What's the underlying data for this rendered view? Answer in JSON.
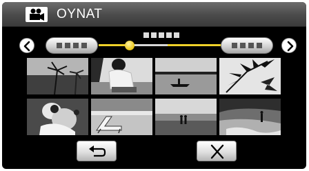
{
  "header": {
    "title": "OYNAT",
    "icon": "movie-camera-icon"
  },
  "navigation": {
    "prev_icon": "chevron-left-icon",
    "next_icon": "chevron-right-icon"
  },
  "thumbnails": [
    {
      "name": "palm-beach-thumbnail"
    },
    {
      "name": "seated-person-thumbnail"
    },
    {
      "name": "canoe-sunset-thumbnail"
    },
    {
      "name": "palm-leaves-thumbnail"
    },
    {
      "name": "couple-hug-thumbnail"
    },
    {
      "name": "beach-chair-thumbnail"
    },
    {
      "name": "silhouette-couple-thumbnail"
    },
    {
      "name": "shore-walk-thumbnail"
    }
  ],
  "buttons": {
    "back_icon": "return-arrow-icon",
    "close_icon": "close-icon"
  },
  "colors": {
    "accent": "#f1d22a",
    "background": "#000000",
    "header": "#4a4a4a"
  }
}
